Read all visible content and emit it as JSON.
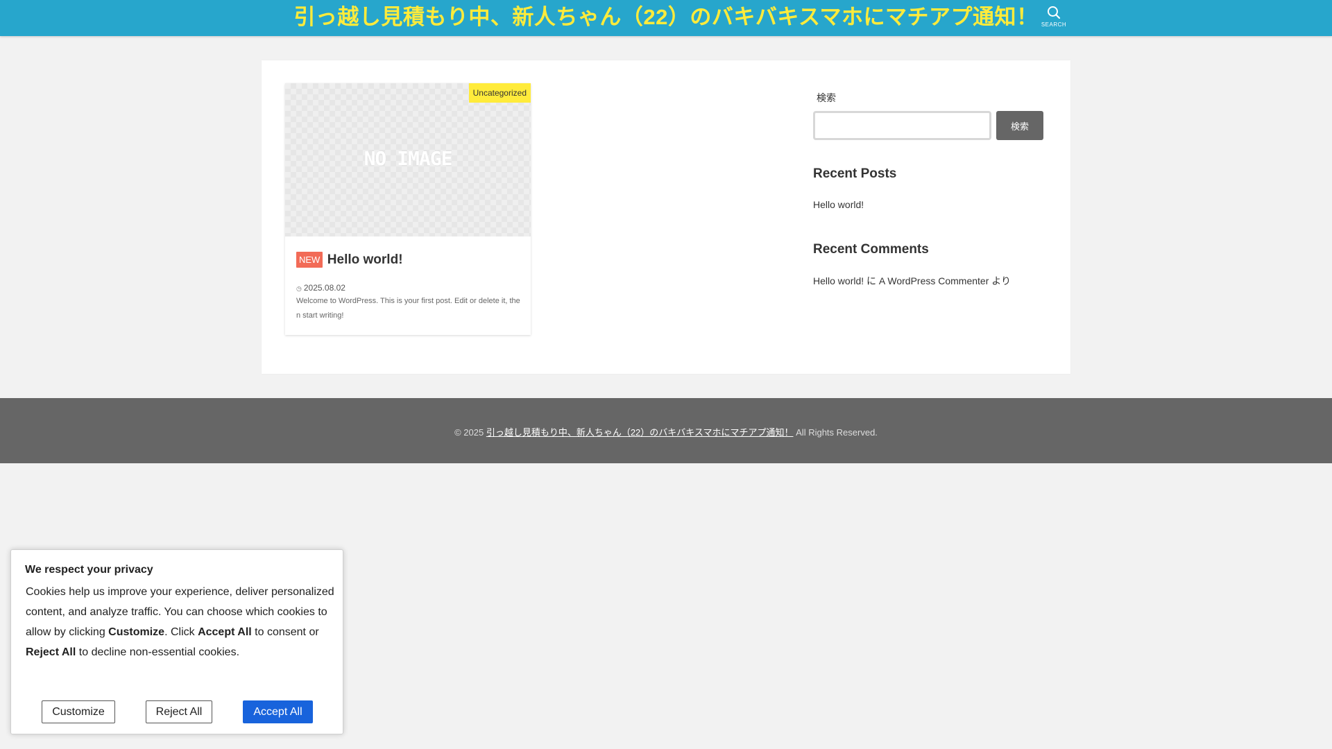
{
  "header": {
    "site_title": "引っ越し見積もり中、新人ちゃん（22）のバキバキスマホにマチアプ通知！",
    "search_label": "SEARCH",
    "search_icon": "search-icon"
  },
  "post": {
    "thumbnail_text": "NO IMAGE",
    "category": "Uncategorized",
    "new_badge": "NEW",
    "title": "Hello world!",
    "date_icon": "clock-icon",
    "date": "2025.08.02",
    "excerpt": "Welcome to WordPress. This is your first post. Edit or delete it, then start writing!"
  },
  "sidebar": {
    "search": {
      "label": "検索",
      "placeholder": "",
      "value": "",
      "button": "検索"
    },
    "recent_posts": {
      "title": "Recent Posts",
      "items": [
        "Hello world!"
      ]
    },
    "recent_comments": {
      "title": "Recent Comments",
      "items": [
        "Hello world! に A WordPress Commenter より"
      ]
    }
  },
  "footer": {
    "copyright_prefix": "© 2025",
    "site_link": "引っ越し見積もり中、新人ちゃん（22）のバキバキスマホにマチアプ通知！",
    "rights": "All Rights Reserved."
  },
  "cookie": {
    "title": "We respect your privacy",
    "body_1": "Cookies help us improve your experience, deliver personalized content, and analyze traffic. You can choose which cookies to allow by clicking ",
    "body_customize": "Customize",
    "body_2": ". Click ",
    "body_accept": "Accept All",
    "body_3": " to consent or ",
    "body_reject": "Reject All",
    "body_4": " to decline non-essential cookies.",
    "buttons": {
      "customize": "Customize",
      "reject": "Reject All",
      "accept": "Accept All"
    }
  },
  "colors": {
    "header_bg": "#27a6cc",
    "title_color": "#ffeb3b",
    "new_badge": "#f26b57",
    "category_badge": "#ffeb3b",
    "footer_bg": "#666666",
    "accept_button": "#1863dc"
  }
}
